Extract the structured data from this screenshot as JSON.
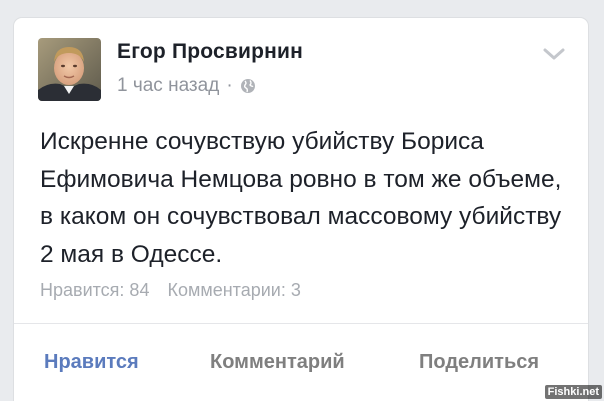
{
  "post": {
    "author": "Егор Просвирнин",
    "time": "1 час назад",
    "separator": "·",
    "privacy_icon": "globe-icon",
    "menu_icon": "chevron-down-icon",
    "text": "Искренне сочувствую убийству Бориса Ефимовича Немцова ровно в том же объеме, в каком он сочувствовал массовому убийству 2 мая в Одессе.",
    "likes": "Нравится: 84",
    "comments": "Комментарии: 3"
  },
  "actions": {
    "like": "Нравится",
    "comment": "Комментарий",
    "share": "Поделиться"
  },
  "watermark": "Fishki.net",
  "colors": {
    "background": "#e9ebee",
    "card": "#ffffff",
    "author_text": "#1d2129",
    "meta_text": "#90949c",
    "like_action": "#5b7bbd",
    "actions": "#7f7f7f"
  }
}
